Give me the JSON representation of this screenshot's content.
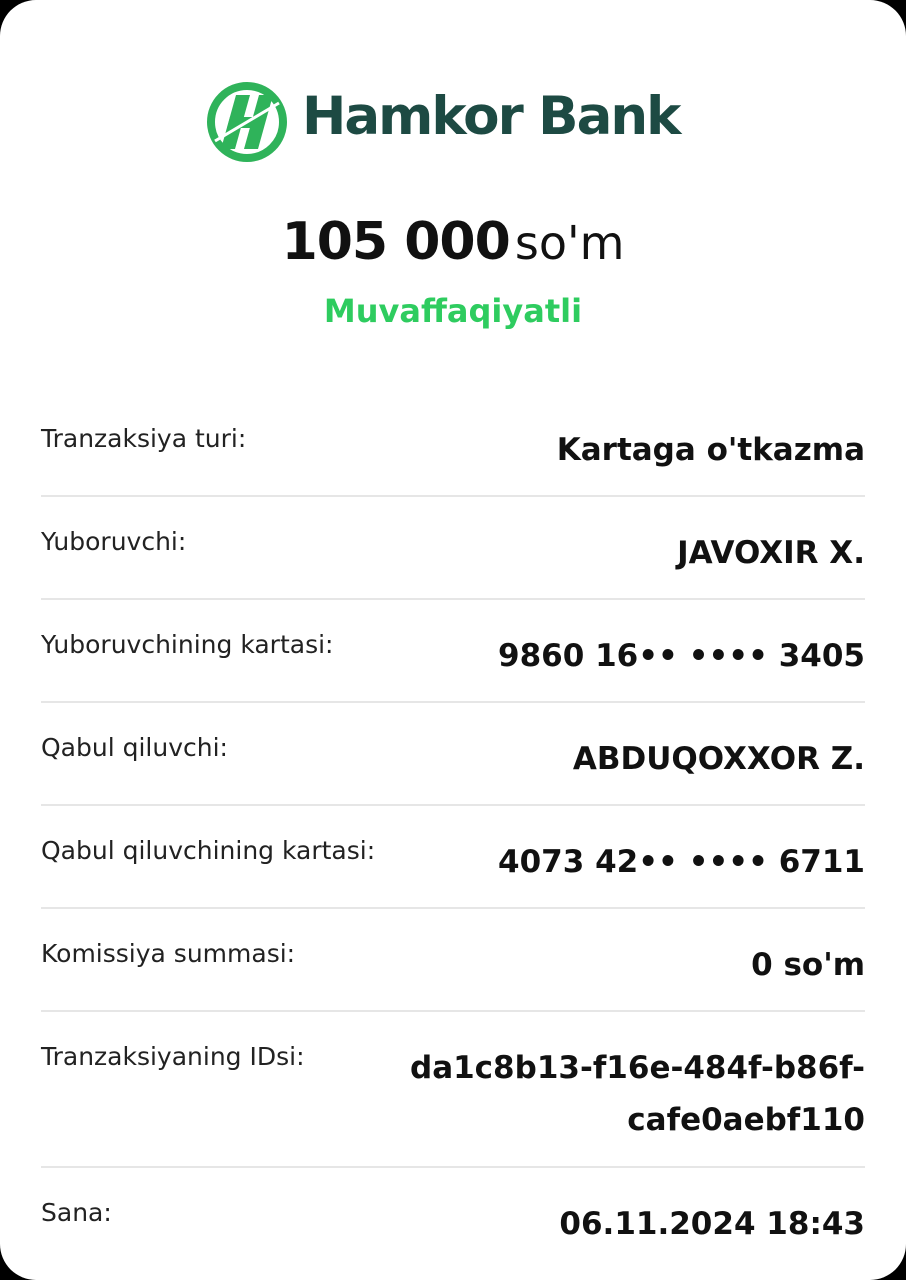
{
  "brand": {
    "name": "Hamkor Bank",
    "colors": {
      "logo_green": "#2fb35a",
      "logo_dark": "#1d4a43"
    },
    "icon": "hamkor-logo-icon"
  },
  "header": {
    "amount": "105 000",
    "currency": "so'm",
    "status": "Muvaffaqiyatli",
    "status_color": "#2ecc5f"
  },
  "details": [
    {
      "label": "Tranzaksiya turi:",
      "value": "Kartaga o'tkazma"
    },
    {
      "label": "Yuboruvchi:",
      "value": "JAVOXIR X."
    },
    {
      "label": "Yuboruvchining kartasi:",
      "value": "9860 16•• •••• 3405"
    },
    {
      "label": "Qabul qiluvchi:",
      "value": "ABDUQOXXOR Z."
    },
    {
      "label": "Qabul qiluvchining kartasi:",
      "value": "4073 42•• •••• 6711"
    },
    {
      "label": "Komissiya summasi:",
      "value": "0 so'm"
    },
    {
      "label": "Tranzaksiyaning IDsi:",
      "value": "da1c8b13-f16e-484f-b86f-\ncafe0aebf110"
    },
    {
      "label": "Sana:",
      "value": "06.11.2024 18:43"
    }
  ]
}
